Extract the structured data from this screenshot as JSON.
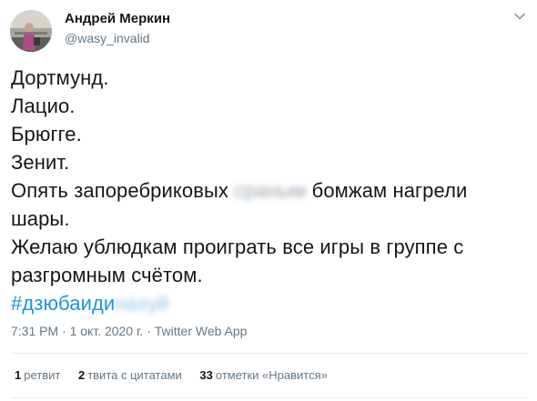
{
  "author": {
    "name": "Андрей Меркин",
    "handle": "@wasy_invalid"
  },
  "icons": {
    "avatar": "profile-photo",
    "menu": "chevron-down-icon"
  },
  "tweet": {
    "lines": [
      "Дортмунд.",
      "Лацио.",
      "Брюгге.",
      "Зенит."
    ],
    "line5_prefix": "Опять запоребриковых ",
    "line5_blurred": "сраным",
    "line5_suffix": " бомжам нагрели",
    "line6": "шары.",
    "line7": "Желаю ублюдкам проиграть все игры в группе с",
    "line8": "разгромным счётом.",
    "hashtag_visible": "#дзюбаиди",
    "hashtag_blurred": "нахуй"
  },
  "meta": {
    "time": "7:31 PM",
    "sep1": " · ",
    "date": "1 окт. 2020 г.",
    "sep2": " · ",
    "source": "Twitter Web App"
  },
  "stats": {
    "retweets_count": "1",
    "retweets_label": "ретвит",
    "quotes_count": "2",
    "quotes_label": "твита с цитатами",
    "likes_count": "33",
    "likes_label": "отметки «Нравится»"
  },
  "colors": {
    "text": "#14171a",
    "secondary": "#657786",
    "link": "#1b95e0",
    "divider": "#e6ecf0"
  }
}
